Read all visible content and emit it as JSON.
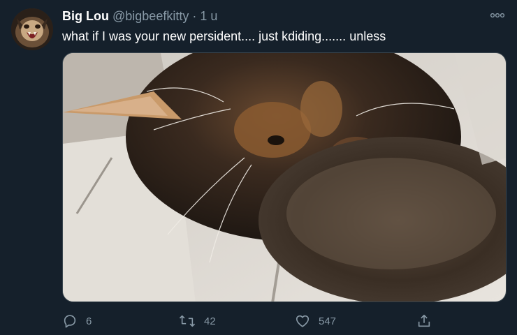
{
  "tweet": {
    "author_name": "Big Lou",
    "author_handle": "@bigbeefkitty",
    "separator": "·",
    "time": "1 u",
    "text": "what if I was your new persident.... just kdiding....... unless",
    "avatar_icon": "cat-avatar",
    "media_description_icon": "cat-photo"
  },
  "actions": {
    "reply_count": "6",
    "retweet_count": "42",
    "like_count": "547"
  },
  "colors": {
    "background": "#15202b",
    "secondary_text": "#8899a6",
    "border": "#38444d"
  }
}
